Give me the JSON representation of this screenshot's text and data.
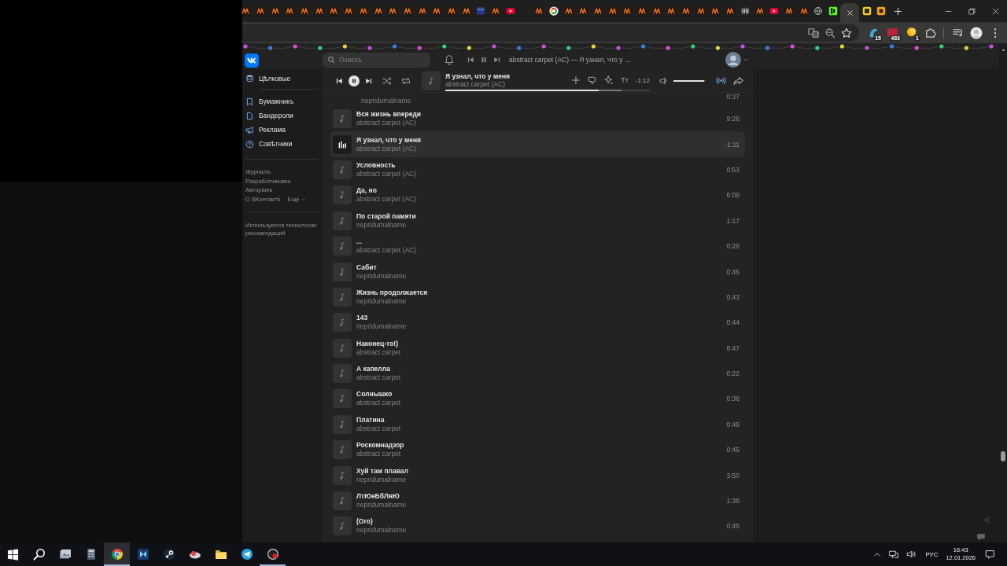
{
  "browser": {
    "tab_groups": [
      [
        {
          "kind": "ne",
          "selected": false
        },
        {
          "kind": "ne",
          "selected": false
        },
        {
          "kind": "ne",
          "selected": false
        },
        {
          "kind": "ne",
          "selected": false
        },
        {
          "kind": "ne",
          "selected": false
        },
        {
          "kind": "ne",
          "selected": false
        },
        {
          "kind": "ne",
          "selected": false
        },
        {
          "kind": "ne",
          "selected": false
        },
        {
          "kind": "ne",
          "selected": false
        },
        {
          "kind": "ne",
          "selected": false
        },
        {
          "kind": "ne",
          "selected": false
        },
        {
          "kind": "ne",
          "selected": false
        },
        {
          "kind": "ne",
          "selected": false
        },
        {
          "kind": "ne",
          "selected": false
        },
        {
          "kind": "ne",
          "selected": false
        },
        {
          "kind": "ne",
          "selected": false
        },
        {
          "kind": "calendar",
          "selected": false
        },
        {
          "kind": "ne",
          "selected": false
        },
        {
          "kind": "youtube",
          "selected": false
        }
      ],
      [
        {
          "kind": "ne",
          "selected": false
        },
        {
          "kind": "google",
          "selected": false
        },
        {
          "kind": "ne",
          "selected": false
        },
        {
          "kind": "ne",
          "selected": false
        },
        {
          "kind": "ne",
          "selected": false
        },
        {
          "kind": "ne",
          "selected": false
        },
        {
          "kind": "ne",
          "selected": false
        },
        {
          "kind": "ne",
          "selected": false
        },
        {
          "kind": "ne",
          "selected": false
        },
        {
          "kind": "ne",
          "selected": false
        },
        {
          "kind": "ne",
          "selected": false
        },
        {
          "kind": "ne",
          "selected": false
        },
        {
          "kind": "ne",
          "selected": false
        },
        {
          "kind": "ne",
          "selected": false
        },
        {
          "kind": "vk",
          "selected": false
        },
        {
          "kind": "ne",
          "selected": false
        },
        {
          "kind": "youtube",
          "selected": false
        },
        {
          "kind": "ne",
          "selected": false
        },
        {
          "kind": "ne",
          "selected": false
        },
        {
          "kind": "globe",
          "selected": false
        },
        {
          "kind": "k",
          "selected": false
        },
        {
          "selected": true
        },
        {
          "kind": "yellow",
          "selected": false
        },
        {
          "kind": "d",
          "selected": false
        }
      ]
    ],
    "extension_badges": [
      "15",
      "483",
      "1"
    ]
  },
  "vk": {
    "search": {
      "placeholder": "Поискъ"
    },
    "now_playing": "abstract carpet (AC) — Я узнал, что у ...",
    "sidebar": {
      "items": [
        {
          "label": "Цѣлковые",
          "kind": "wallet"
        },
        {
          "label": "Бумажникъ",
          "kind": "bookmark"
        },
        {
          "label": "Бандероли",
          "kind": "document"
        },
        {
          "label": "Реклама",
          "kind": "megaphone"
        },
        {
          "label": "Совѣтники",
          "kind": "help"
        }
      ],
      "footer_links": [
        "Журналъ",
        "Разработчикамъ",
        "Авторамъ",
        "О ВКонтактѣ"
      ],
      "more_link": "Еще",
      "note": "Используются технологии рекомендаций"
    },
    "player": {
      "playing": true,
      "title": "Я узнал, что у меня",
      "artist": "abstract carpet (AC)",
      "lyrics_label": "Tт",
      "time": "-1:12",
      "progress": {
        "level": 0.75
      },
      "buffer": {
        "level": 0.86
      },
      "volume": {
        "level": 0.95
      },
      "broadcast_on": true
    },
    "tracks": [
      {
        "artist": "nepridumalname",
        "duration": "0:37",
        "selected": false
      },
      {
        "title": "Вся жизнь впереди",
        "artist": "abstract carpet (AC)",
        "duration": "9:26",
        "selected": false
      },
      {
        "title": "Я узнал, что у меня",
        "artist": "abstract carpet (AC)",
        "duration": "-1:11",
        "selected": true
      },
      {
        "title": "Условность",
        "artist": "abstract carpet (AC)",
        "duration": "0:53",
        "selected": false
      },
      {
        "title": "Да, но",
        "artist": "abstract carpet (AC)",
        "duration": "6:09",
        "selected": false
      },
      {
        "title": "По старой памяти",
        "artist": "nepridumalname",
        "duration": "1:17",
        "selected": false
      },
      {
        "title": "...",
        "artist": "abstract carpet (AC)",
        "duration": "0:26",
        "selected": false
      },
      {
        "title": "Сабит",
        "artist": "nepridumalname",
        "duration": "0:46",
        "selected": false
      },
      {
        "title": "Жизнь продолжается",
        "artist": "nepridumalname",
        "duration": "0:43",
        "selected": false
      },
      {
        "title": "143",
        "artist": "nepridumalname",
        "duration": "0:44",
        "selected": false
      },
      {
        "title": "Наконец-то!)",
        "artist": "abstract carpet",
        "duration": "6:47",
        "selected": false
      },
      {
        "title": "А капелла",
        "artist": "abstract carpet",
        "duration": "0:22",
        "selected": false
      },
      {
        "title": "Солнышко",
        "artist": "abstract carpet",
        "duration": "0:36",
        "selected": false
      },
      {
        "title": "Платина",
        "artist": "abstract carpet",
        "duration": "0:46",
        "selected": false
      },
      {
        "title": "Роскомнадзор",
        "artist": "abstract carpet",
        "duration": "0:45",
        "selected": false
      },
      {
        "title": "Хуй там плавал",
        "artist": "nepridumalname",
        "duration": "3:50",
        "selected": false
      },
      {
        "title": "ЛтЮеБбЛяЮ",
        "artist": "nepridumalname",
        "duration": "1:38",
        "selected": false
      },
      {
        "title": "(Ого)",
        "artist": "nepridumalname",
        "duration": "0:45",
        "selected": false
      }
    ]
  },
  "taskbar": {
    "apps": [
      {
        "kind": "gallery",
        "selected": false,
        "running": false
      },
      {
        "kind": "calculator",
        "selected": false,
        "running": false
      },
      {
        "kind": "chrome",
        "selected": true,
        "running": true
      },
      {
        "kind": "editor",
        "selected": false,
        "running": false
      },
      {
        "kind": "steam",
        "selected": false,
        "running": false
      },
      {
        "kind": "bird",
        "selected": false,
        "running": false
      },
      {
        "kind": "folder",
        "selected": false,
        "running": false
      },
      {
        "kind": "telegram",
        "selected": false,
        "running": false
      },
      {
        "kind": "recorder",
        "selected": false,
        "running": true
      }
    ],
    "tray": {
      "language": "РУС",
      "time": "16:43",
      "date": "12.01.2026"
    }
  }
}
